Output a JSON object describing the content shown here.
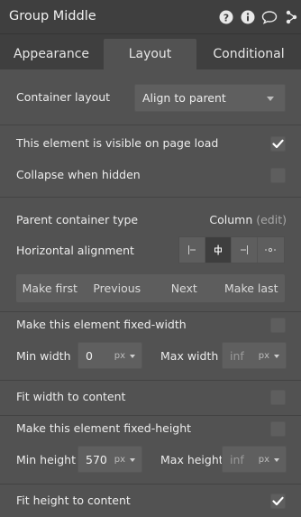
{
  "header": {
    "title": "Group Middle",
    "icons": [
      "help-icon",
      "info-icon",
      "comment-icon",
      "graph-icon"
    ]
  },
  "tabs": [
    {
      "label": "Appearance"
    },
    {
      "label": "Layout"
    },
    {
      "label": "Conditional"
    }
  ],
  "active_tab": "Layout",
  "container_layout": {
    "label": "Container layout",
    "value": "Align to parent"
  },
  "visibility": {
    "visible_label": "This element is visible on page load",
    "visible_checked": true,
    "collapse_label": "Collapse when hidden",
    "collapse_checked": false
  },
  "parent_type": {
    "label": "Parent container type",
    "value": "Column",
    "edit": "(edit)"
  },
  "horizontal_alignment": {
    "label": "Horizontal alignment",
    "options": [
      "align-left-icon",
      "align-center-icon",
      "align-right-icon",
      "distribute-icon"
    ],
    "selected": "align-center-icon"
  },
  "order_nav": {
    "make_first": "Make first",
    "previous": "Previous",
    "next": "Next",
    "make_last": "Make last"
  },
  "width": {
    "fixed_label": "Make this element fixed-width",
    "fixed_checked": false,
    "min_label": "Min width",
    "min_value": "0",
    "min_unit": "px",
    "max_label": "Max width",
    "max_placeholder": "inf",
    "max_unit": "px",
    "fit_label": "Fit width to content",
    "fit_checked": false
  },
  "height": {
    "fixed_label": "Make this element fixed-height",
    "fixed_checked": false,
    "min_label": "Min height",
    "min_value": "570",
    "min_unit": "px",
    "max_label": "Max height",
    "max_placeholder": "inf",
    "max_unit": "px",
    "fit_label": "Fit height to content",
    "fit_checked": true
  },
  "colors": {
    "header_bg": "#3f3f3f",
    "panel_bg": "#525252",
    "field_bg": "#5f5f5f",
    "active_align_bg": "#3e3e3e"
  }
}
